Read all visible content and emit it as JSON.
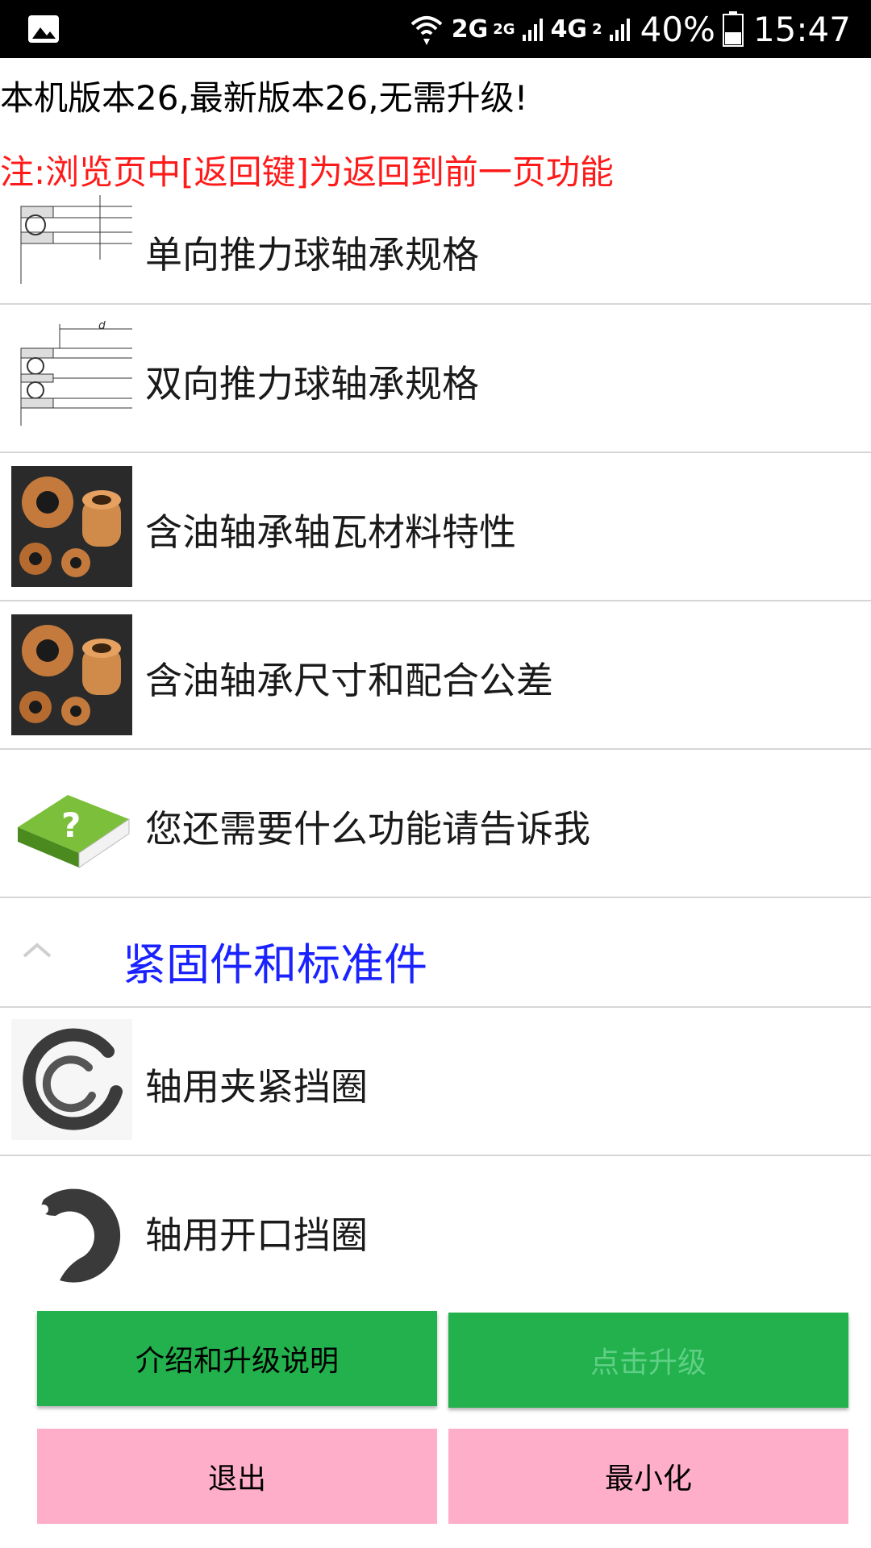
{
  "status_bar": {
    "network_primary": "2G",
    "network_secondary": "2G",
    "lte_label": "4G",
    "sim2_label": "2",
    "battery": "40%",
    "time": "15:47"
  },
  "header": {
    "version_text": "本机版本26,最新版本26,无需升级!",
    "note_text": "注:浏览页中[返回键]为返回到前一页功能"
  },
  "list": {
    "items": [
      {
        "label": "单向推力球轴承规格",
        "icon": "thrust-bearing-single-icon"
      },
      {
        "label": "双向推力球轴承规格",
        "icon": "thrust-bearing-double-icon"
      },
      {
        "label": "含油轴承轴瓦材料特性",
        "icon": "oil-bearing-icon"
      },
      {
        "label": "含油轴承尺寸和配合公差",
        "icon": "oil-bearing-icon"
      },
      {
        "label": "您还需要什么功能请告诉我",
        "icon": "question-book-icon"
      }
    ],
    "section": {
      "label": "紧固件和标准件",
      "icon": "chevron-up-icon"
    },
    "section_items": [
      {
        "label": "轴用夹紧挡圈",
        "icon": "clamp-ring-icon"
      },
      {
        "label": "轴用开口挡圈",
        "icon": "e-clip-icon"
      }
    ]
  },
  "buttons": {
    "intro": "介绍和升级说明",
    "upgrade": "点击升级",
    "exit": "退出",
    "minimize": "最小化"
  },
  "colors": {
    "note_red": "#ff1a1a",
    "section_blue": "#1a22ff",
    "button_green": "#22b14c",
    "button_pink": "#ffaec9"
  }
}
